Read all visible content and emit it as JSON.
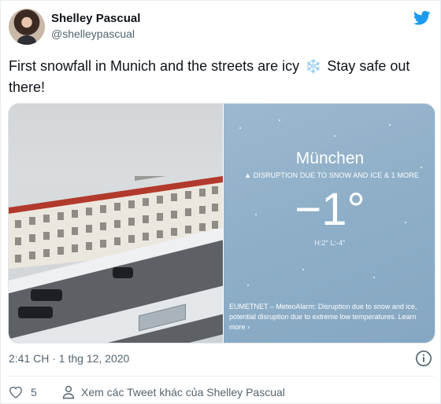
{
  "author": {
    "name": "Shelley Pascual",
    "handle": "@shelleypascual"
  },
  "tweet": {
    "text_before": "First snowfall in Munich and the streets are icy",
    "emoji": "❄️",
    "text_after": "Stay safe out there!"
  },
  "weather_card": {
    "city": "München",
    "alert": "▲ DISRUPTION DUE TO SNOW AND ICE & 1 MORE",
    "temperature": "−1°",
    "high_low": "H:2°  L:-4°",
    "meteo_text": "EUMETNET – MeteoAlarm: Disruption due to snow and ice, potential disruption due to extreme low temperatures. Learn more ›"
  },
  "meta": {
    "timestamp": "2:41 CH · 1 thg 12, 2020"
  },
  "actions": {
    "like_count": "5",
    "more_tweets_label": "Xem các Tweet khác của Shelley Pascual"
  },
  "icons": {
    "brand": "twitter-bird-icon",
    "info": "info-icon",
    "like": "heart-icon",
    "profile": "person-icon"
  },
  "colors": {
    "twitter_blue": "#1d9bf0",
    "secondary_text": "#536471"
  }
}
